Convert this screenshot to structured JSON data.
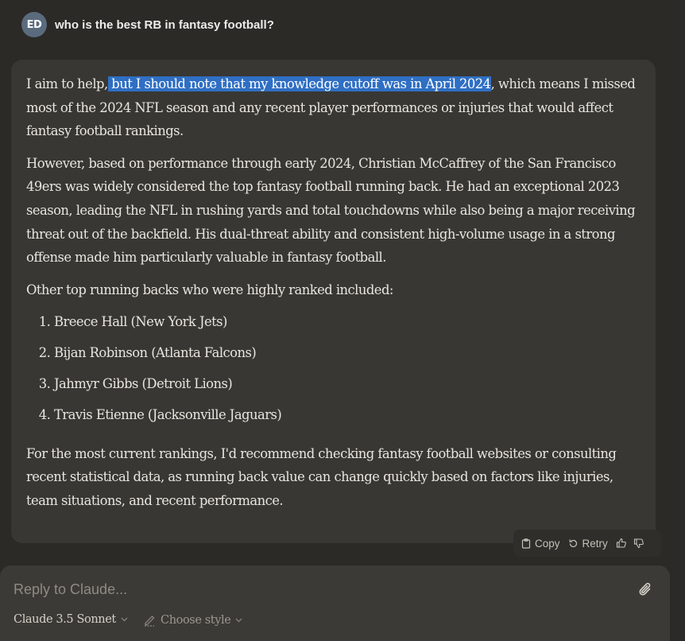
{
  "user_message": {
    "avatar_initials": "ED",
    "text": "who is the best RB in fantasy football?"
  },
  "response": {
    "p1_before": "I aim to help,",
    "p1_highlight": " but I should note that my knowledge cutoff was in April 2024",
    "p1_after": ", which means I missed most of the 2024 NFL season and any recent player performances or injuries that would affect fantasy football rankings.",
    "p2": "However, based on performance through early 2024, Christian McCaffrey of the San Francisco 49ers was widely considered the top fantasy football running back. He had an exceptional 2023 season, leading the NFL in rushing yards and total touchdowns while also being a major receiving threat out of the backfield. His dual-threat ability and consistent high-volume usage in a strong offense made him particularly valuable in fantasy football.",
    "p3": "Other top running backs who were highly ranked included:",
    "list": [
      "Breece Hall (New York Jets)",
      "Bijan Robinson (Atlanta Falcons)",
      "Jahmyr Gibbs (Detroit Lions)",
      "Travis Etienne (Jacksonville Jaguars)"
    ],
    "p4": "For the most current rankings, I'd recommend checking fantasy football websites or consulting recent statistical data, as running back value can change quickly based on factors like injuries, team situations, and recent performance."
  },
  "actions": {
    "copy_label": "Copy",
    "retry_label": "Retry"
  },
  "composer": {
    "placeholder": "Reply to Claude...",
    "model_label": "Claude 3.5 Sonnet",
    "style_label": "Choose style"
  },
  "colors": {
    "background": "#2b2a27",
    "response_bg": "#383733",
    "highlight": "#2f6fc4",
    "avatar_bg": "#5b6b7e",
    "composer_bg": "#3b3a36"
  }
}
